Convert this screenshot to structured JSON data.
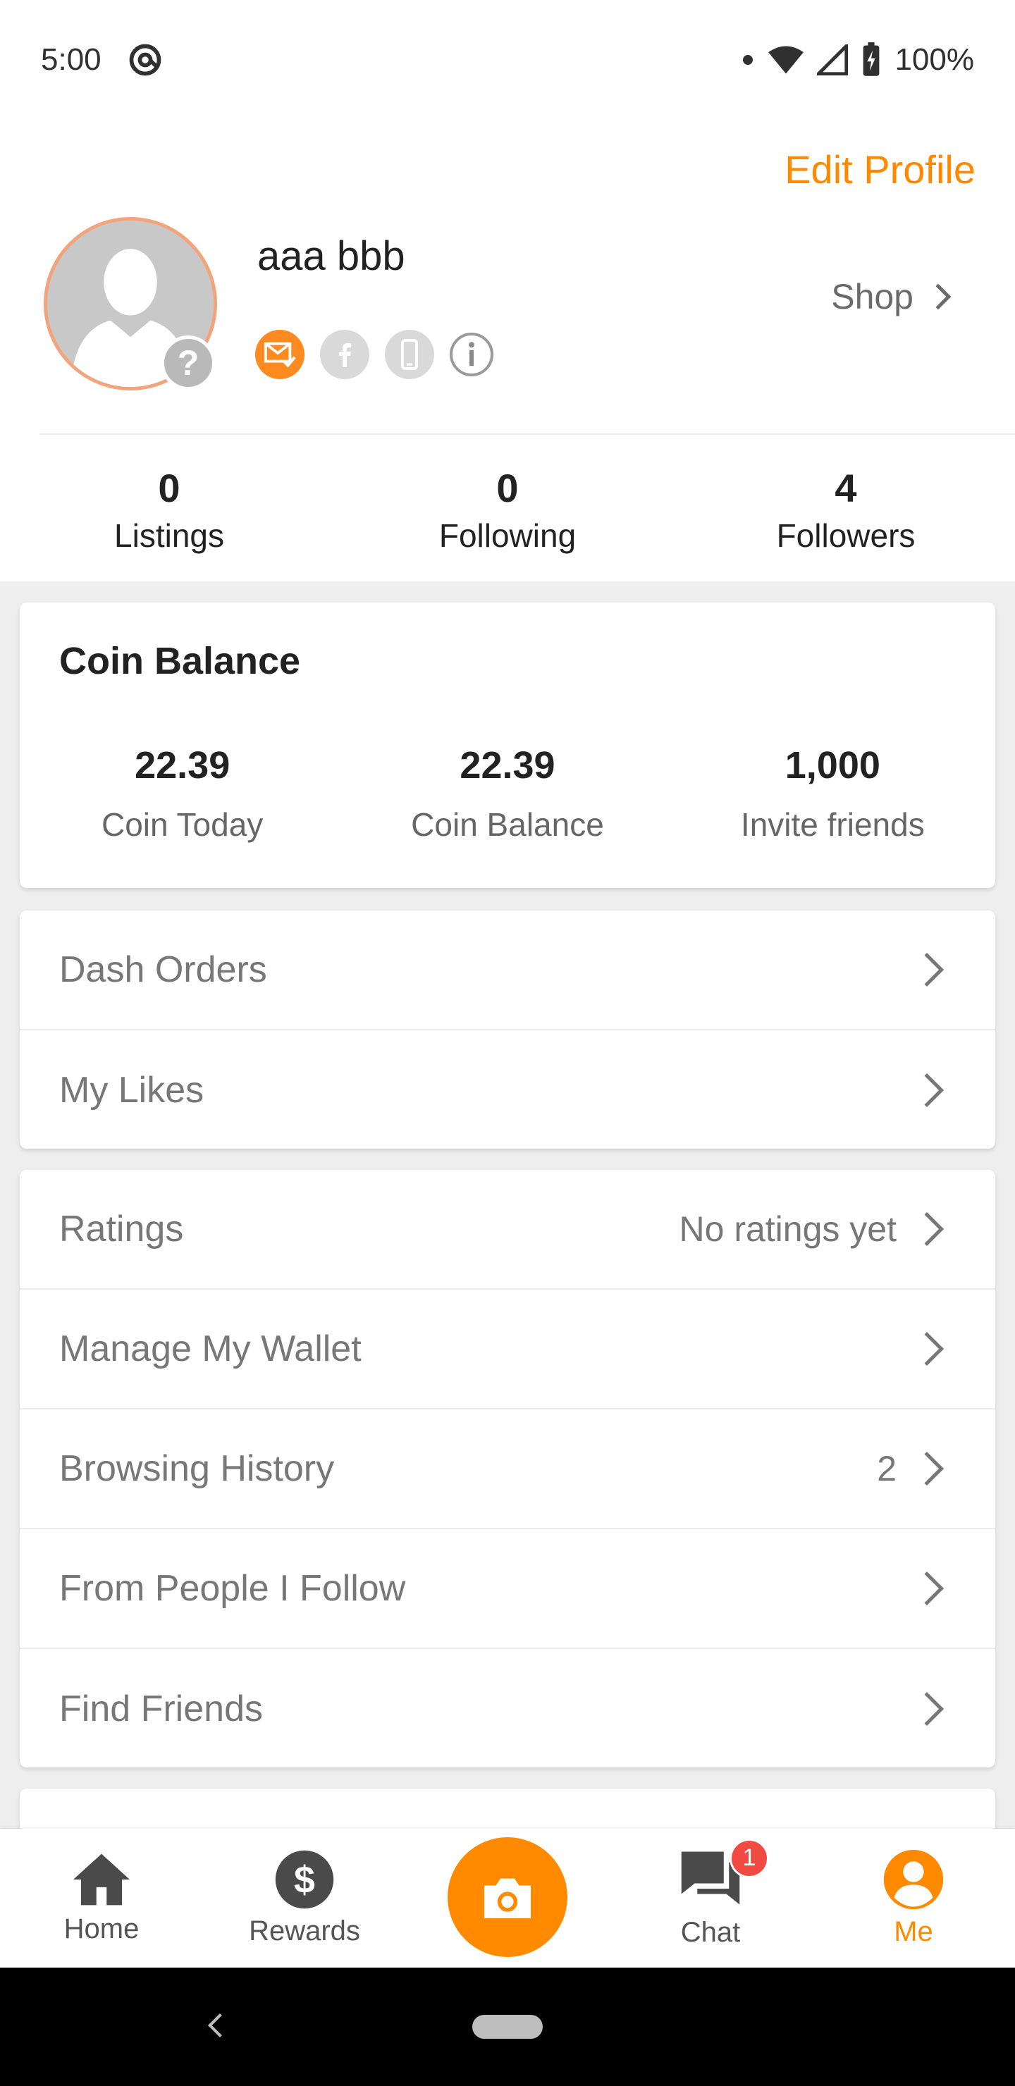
{
  "status_bar": {
    "time": "5:00",
    "battery": "100%"
  },
  "profile": {
    "edit_label": "Edit Profile",
    "name": "aaa bbb",
    "shop_label": "Shop",
    "avatar_help": "?",
    "stats": [
      {
        "value": "0",
        "label": "Listings"
      },
      {
        "value": "0",
        "label": "Following"
      },
      {
        "value": "4",
        "label": "Followers"
      }
    ]
  },
  "coin": {
    "title": "Coin Balance",
    "items": [
      {
        "value": "22.39",
        "label": "Coin Today"
      },
      {
        "value": "22.39",
        "label": "Coin Balance"
      },
      {
        "value": "1,000",
        "label": "Invite friends"
      }
    ]
  },
  "menu_group1": [
    {
      "label": "Dash Orders",
      "value": ""
    },
    {
      "label": "My Likes",
      "value": ""
    }
  ],
  "menu_group2": [
    {
      "label": "Ratings",
      "value": "No ratings yet"
    },
    {
      "label": "Manage My Wallet",
      "value": ""
    },
    {
      "label": "Browsing History",
      "value": "2"
    },
    {
      "label": "From People I Follow",
      "value": ""
    },
    {
      "label": "Find Friends",
      "value": ""
    }
  ],
  "nav": {
    "items": [
      {
        "label": "Home",
        "icon": "home-icon"
      },
      {
        "label": "Rewards",
        "icon": "dollar-icon"
      },
      {
        "label": "",
        "icon": "camera-icon"
      },
      {
        "label": "Chat",
        "icon": "chat-icon",
        "badge": "1"
      },
      {
        "label": "Me",
        "icon": "person-icon",
        "active": true
      }
    ]
  },
  "colors": {
    "accent": "#ff8a00",
    "badge": "#f04a43",
    "muted_text": "#777777"
  }
}
